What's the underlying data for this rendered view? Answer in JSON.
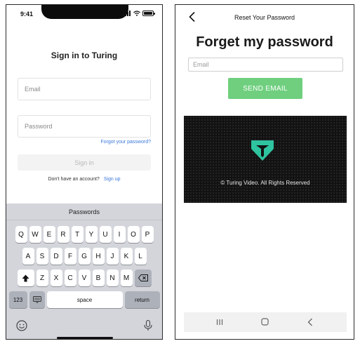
{
  "left_screen": {
    "status_time": "9:41",
    "title": "Sign in to Turing",
    "email_placeholder": "Email",
    "password_placeholder": "Password",
    "forgot_link": "Forgot your password?",
    "signin_label": "Sign in",
    "no_account_text": "Don't have an account?",
    "signup_link": "Sign up",
    "keyboard": {
      "suggestion": "Passwords",
      "row1": [
        "Q",
        "W",
        "E",
        "R",
        "T",
        "Y",
        "U",
        "I",
        "O",
        "P"
      ],
      "row2": [
        "A",
        "S",
        "D",
        "F",
        "G",
        "H",
        "J",
        "K",
        "L"
      ],
      "row3": [
        "Z",
        "X",
        "C",
        "V",
        "B",
        "N",
        "M"
      ],
      "num_key": "123",
      "space_key": "space",
      "return_key": "return",
      "icons": [
        "shift-icon",
        "backspace-icon",
        "keyboard-emoji-icon",
        "emoji-icon",
        "mic-icon"
      ]
    }
  },
  "right_screen": {
    "appbar_title": "Reset Your Password",
    "heading": "Forget my password",
    "email_placeholder": "Email",
    "send_label": "SEND EMAIL",
    "copyright": "© Turing Video. All Rights Reserved",
    "icons": [
      "back-icon",
      "turing-logo-icon",
      "nav-recent-icon",
      "nav-home-icon",
      "nav-back-icon"
    ]
  },
  "colors": {
    "link_blue": "#3a78d9",
    "send_green": "#6fcf7f",
    "logo_teal": "#2ec4a0",
    "keyboard_bg": "#d3d5db",
    "panel_dark": "#121212"
  }
}
